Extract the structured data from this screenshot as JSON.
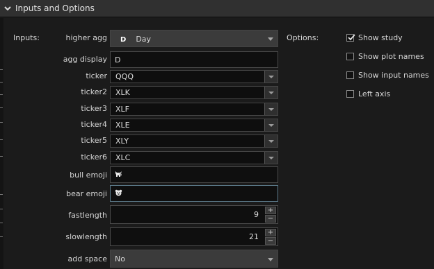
{
  "panel": {
    "title": "Inputs and Options"
  },
  "sections": {
    "inputs_label": "Inputs:",
    "options_label": "Options:"
  },
  "inputs": {
    "higher_agg": {
      "label": "higher agg",
      "badge": "D",
      "value": "Day"
    },
    "agg_display": {
      "label": "agg display",
      "value": "D"
    },
    "tickers": [
      {
        "label": "ticker",
        "value": "QQQ"
      },
      {
        "label": "ticker2",
        "value": "XLK"
      },
      {
        "label": "ticker3",
        "value": "XLF"
      },
      {
        "label": "ticker4",
        "value": "XLE"
      },
      {
        "label": "ticker5",
        "value": "XLY"
      },
      {
        "label": "ticker6",
        "value": "XLC"
      }
    ],
    "bull_emoji": {
      "label": "bull emoji",
      "icon": "bull-icon"
    },
    "bear_emoji": {
      "label": "bear emoji",
      "icon": "bear-icon"
    },
    "fastlength": {
      "label": "fastlength",
      "value": "9"
    },
    "slowlength": {
      "label": "slowlength",
      "value": "21"
    },
    "add_space": {
      "label": "add space",
      "value": "No"
    },
    "spin_plus": "+",
    "spin_minus": "−"
  },
  "options": [
    {
      "label": "Show study",
      "checked": true
    },
    {
      "label": "Show plot names",
      "checked": false
    },
    {
      "label": "Show input names",
      "checked": false
    },
    {
      "label": "Left axis",
      "checked": false
    }
  ],
  "colors": {
    "background": "#1b1b1b",
    "titlebar": "#303030",
    "dropdown": "#3b3b3b",
    "focus_border": "#5d7c8c"
  }
}
